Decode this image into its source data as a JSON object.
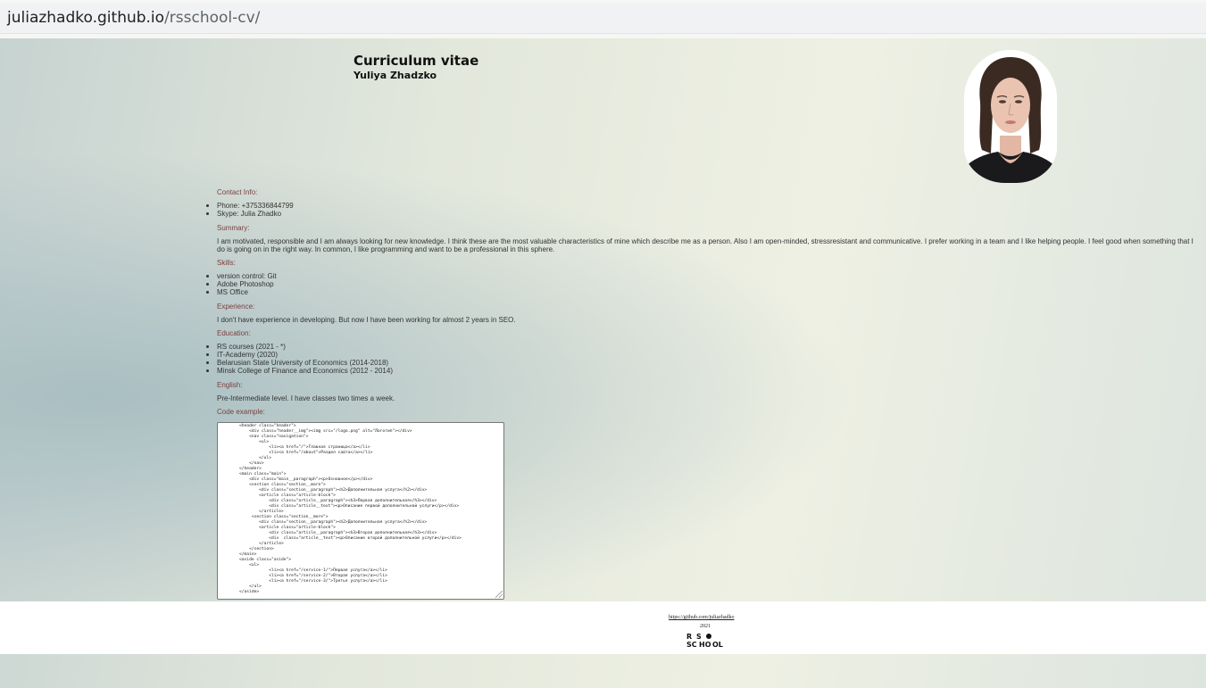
{
  "browser": {
    "url_host": "juliazhadko.github.io",
    "url_path": "/rsschool-cv/"
  },
  "header": {
    "title": "Curriculum vitae",
    "name": "Yuliya Zhadzko"
  },
  "contact": {
    "heading": "Contact Info:",
    "items": [
      "Phone: +375336844799",
      "Skype: Julia Zhadko"
    ]
  },
  "summary": {
    "heading": "Summary:",
    "text": "I am motivated, responsible and I am always looking for new knowledge. I think these are the most valuable characteristics of mine which describe me as a person. Also I am open-minded, stressresistant and communicative. I prefer working in a team and I like helping people. I feel good when something that I do is going on in the right way. In common, I like programming and want to be a professional in this sphere."
  },
  "skills": {
    "heading": "Skills:",
    "items": [
      "version control: Git",
      "Adobe Photoshop",
      "MS Office"
    ]
  },
  "experience": {
    "heading": "Experience:",
    "text": "I don't have experience in developing. But now I have been working for almost 2 years in SEO."
  },
  "education": {
    "heading": "Education:",
    "items": [
      "RS courses (2021 - *)",
      "IT-Academy (2020)",
      "Belarusian State University of Economics (2014-2018)",
      "Minsk College of Finance and Economics (2012 - 2014)"
    ]
  },
  "english": {
    "heading": "English:",
    "text": "Pre-Intermediate level. I have classes two times a week."
  },
  "code": {
    "heading": "Code example:",
    "text": "<header class=\"header\">\n    <div class=\"header__img\"><img src=\"/logo.png\" alt=\"Логотип\"></div>\n    <nav class=\"navigation\">\n        <ul>\n            <li><a href=\"/\">Главная страница</a></li>\n            <li><a href=\"/about\">Раздел сайта</a></li>\n        </ul>\n    </nav>\n</header>\n<main class=\"main\">\n    <div class=\"main__paragraph\"><p>Основное</p></div>\n    <section class=\"section__more\">\n        <div class=\"section__paragraph\"><h2>Дополнительная услуга</h2></div>\n        <article class=\"article-block\">\n            <div class=\"article__paragraph\"><h3>Первая дополнительная</h3></div>\n            <div class=\"article__text\"><p>Описание первой дополнительной услуги</p></div>\n        </article>\n     <section class=\"section__more\">\n        <div class=\"section__paragraph\"><h2>Дополнительная услуга</h2></div>\n        <article class=\"article-block\">\n            <div class=\"article__paragraph\"><h3>Вторая дополнительная</h3></div>\n            <div  class=\"article__text\"><p>Описание второй дополнительной услуги</p></div>\n        </article>\n    </section>\n</main>\n<aside class=\"aside\">\n    <ul>\n            <li><a href=\"/service-1/\">Первая услуга</a></li>\n            <li><a href=\"/service-2/\">Вторая услуга</a></li>\n            <li><a href=\"/service-3/\">Третья услуга</a></li>\n    </ul>\n</aside>"
  },
  "footer": {
    "github_link": "https://github.com/juliazhadko",
    "year": "2021",
    "logo_text": "RS SCHOOL"
  }
}
